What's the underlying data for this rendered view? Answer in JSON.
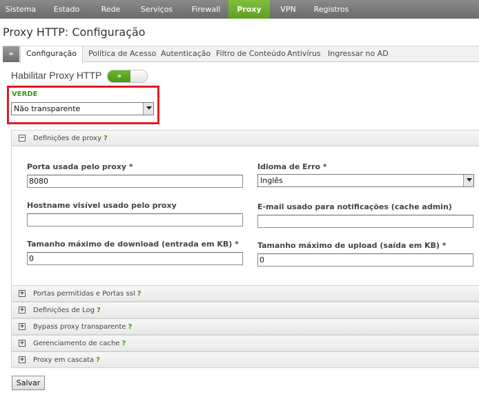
{
  "nav": {
    "items": [
      {
        "label": "Sistema"
      },
      {
        "label": "Estado"
      },
      {
        "label": "Rede"
      },
      {
        "label": "Serviços"
      },
      {
        "label": "Firewall"
      },
      {
        "label": "Proxy",
        "active": true
      },
      {
        "label": "VPN"
      },
      {
        "label": "Registros"
      }
    ]
  },
  "page": {
    "title": "Proxy HTTP: Configuração"
  },
  "tabs": {
    "toggle_icon": "»",
    "items": [
      {
        "label": "Configuração",
        "active": true
      },
      {
        "label": "Política de Acesso"
      },
      {
        "label": "Autenticação"
      },
      {
        "label": "Filtro de Conteúdo"
      },
      {
        "label": "Antivírus"
      },
      {
        "label": "Ingressar no AD"
      }
    ]
  },
  "enable_proxy": {
    "label": "Habilitar Proxy HTTP",
    "toggle_icon": "»",
    "state": "on"
  },
  "verde": {
    "label": "VERDE",
    "mode_value": "Não transparente"
  },
  "panels": {
    "proxy_settings": {
      "title": "Definições de proxy",
      "help": "?",
      "toggle": "−"
    },
    "collapsed": [
      {
        "title": "Portas permitidas e Portas ssl",
        "help": "?",
        "toggle": "+"
      },
      {
        "title": "Definições de Log",
        "help": "?",
        "toggle": "+"
      },
      {
        "title": "Bypass proxy transparente",
        "help": "?",
        "toggle": "+"
      },
      {
        "title": "Gerenciamento de cache",
        "help": "?",
        "toggle": "+"
      },
      {
        "title": "Proxy em cascata",
        "help": "?",
        "toggle": "+"
      }
    ]
  },
  "form": {
    "port": {
      "label": "Porta usada pelo proxy *",
      "value": "8080"
    },
    "error_language": {
      "label": "Idioma de Erro *",
      "value": "Inglês"
    },
    "hostname": {
      "label": "Hostname visível usado pelo proxy",
      "value": ""
    },
    "admin_email": {
      "label": "E-mail usado para notificações (cache admin)",
      "value": ""
    },
    "max_download": {
      "label": "Tamanho máximo de download (entrada em KB) *",
      "value": "0"
    },
    "max_upload": {
      "label": "Tamanho máximo de upload (saída em KB) *",
      "value": "0"
    }
  },
  "actions": {
    "save_label": "Salvar"
  },
  "colors": {
    "nav_active": "#6aaf2b",
    "help_green": "#3c9a10",
    "highlight_red": "#e01b22"
  }
}
